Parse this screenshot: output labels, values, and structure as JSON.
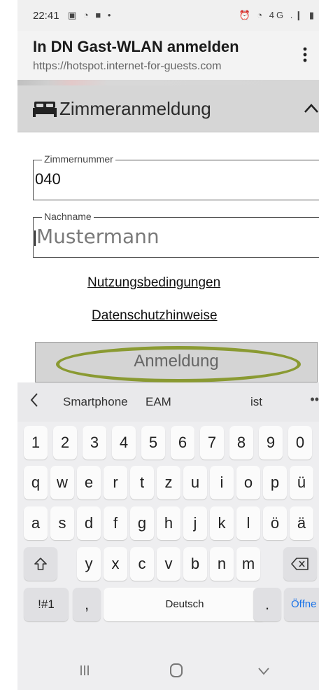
{
  "status_bar": {
    "time": "22:41",
    "left_icons": "▣ ◔ ■ •",
    "right_icons": "⏰ ◔ 4G .❙ ▮"
  },
  "browser": {
    "title": "In DN Gast-WLAN anmelden",
    "url": "https://hotspot.internet-for-guests.com",
    "menu_icon": "more-vertical-icon"
  },
  "section": {
    "title": "Zimmeranmeldung",
    "icon": "bed-icon",
    "toggle_icon": "chevron-up-icon"
  },
  "form": {
    "room": {
      "legend": "Zimmernummer",
      "value": "040"
    },
    "lastname": {
      "legend": "Nachname",
      "placeholder": "Mustermann"
    },
    "terms_link": "Nutzungsbedingungen",
    "privacy_link": "Datenschutzhinweise",
    "submit_label": "Anmeldung"
  },
  "keyboard": {
    "suggestions": [
      "Smartphone",
      "EAM",
      "ist"
    ],
    "more": "••",
    "row_numbers": [
      "1",
      "2",
      "3",
      "4",
      "5",
      "6",
      "7",
      "8",
      "9",
      "0"
    ],
    "row_1": [
      "q",
      "w",
      "e",
      "r",
      "t",
      "z",
      "u",
      "i",
      "o",
      "p",
      "ü"
    ],
    "row_2": [
      "a",
      "s",
      "d",
      "f",
      "g",
      "h",
      "j",
      "k",
      "l",
      "ö",
      "ä"
    ],
    "row_3": [
      "y",
      "x",
      "c",
      "v",
      "b",
      "n",
      "m"
    ],
    "symbols_key": "!#1",
    "comma_key": ",",
    "space_label": "Deutsch",
    "period_key": ".",
    "go_key": "Öffne"
  },
  "colors": {
    "highlight_ring": "#8a9a32",
    "go_key": "#1a73e8",
    "section_bg": "#d6d6d6"
  }
}
